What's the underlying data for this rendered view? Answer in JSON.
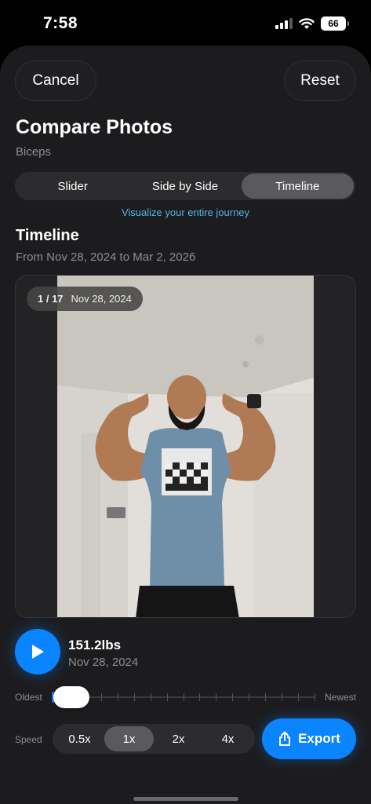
{
  "status_bar": {
    "time": "7:58",
    "battery": "66"
  },
  "header": {
    "cancel_label": "Cancel",
    "reset_label": "Reset"
  },
  "page": {
    "title": "Compare Photos",
    "subtitle": "Biceps"
  },
  "modes": {
    "options": [
      "Slider",
      "Side by Side",
      "Timeline"
    ],
    "selected": "Timeline",
    "hint": "Visualize your entire journey"
  },
  "timeline": {
    "title": "Timeline",
    "range": "From Nov 28, 2024 to Mar 2, 2026",
    "counter_index": "1 / 17",
    "counter_date": "Nov 28, 2024",
    "photo_subject": "progress photo: man flexing biceps in tank top",
    "current_weight": "151.2lbs",
    "current_date": "Nov 28, 2024",
    "position": 0,
    "total_frames": 17
  },
  "slider": {
    "oldest_label": "Oldest",
    "newest_label": "Newest"
  },
  "speed": {
    "label": "Speed",
    "options": [
      "0.5x",
      "1x",
      "2x",
      "4x"
    ],
    "selected": "1x"
  },
  "actions": {
    "export_label": "Export"
  },
  "colors": {
    "accent": "#0a84ff",
    "hint": "#4fb6e6",
    "sheet": "#1c1c1e"
  },
  "icons": {
    "play": "play-icon",
    "export": "share-icon"
  }
}
